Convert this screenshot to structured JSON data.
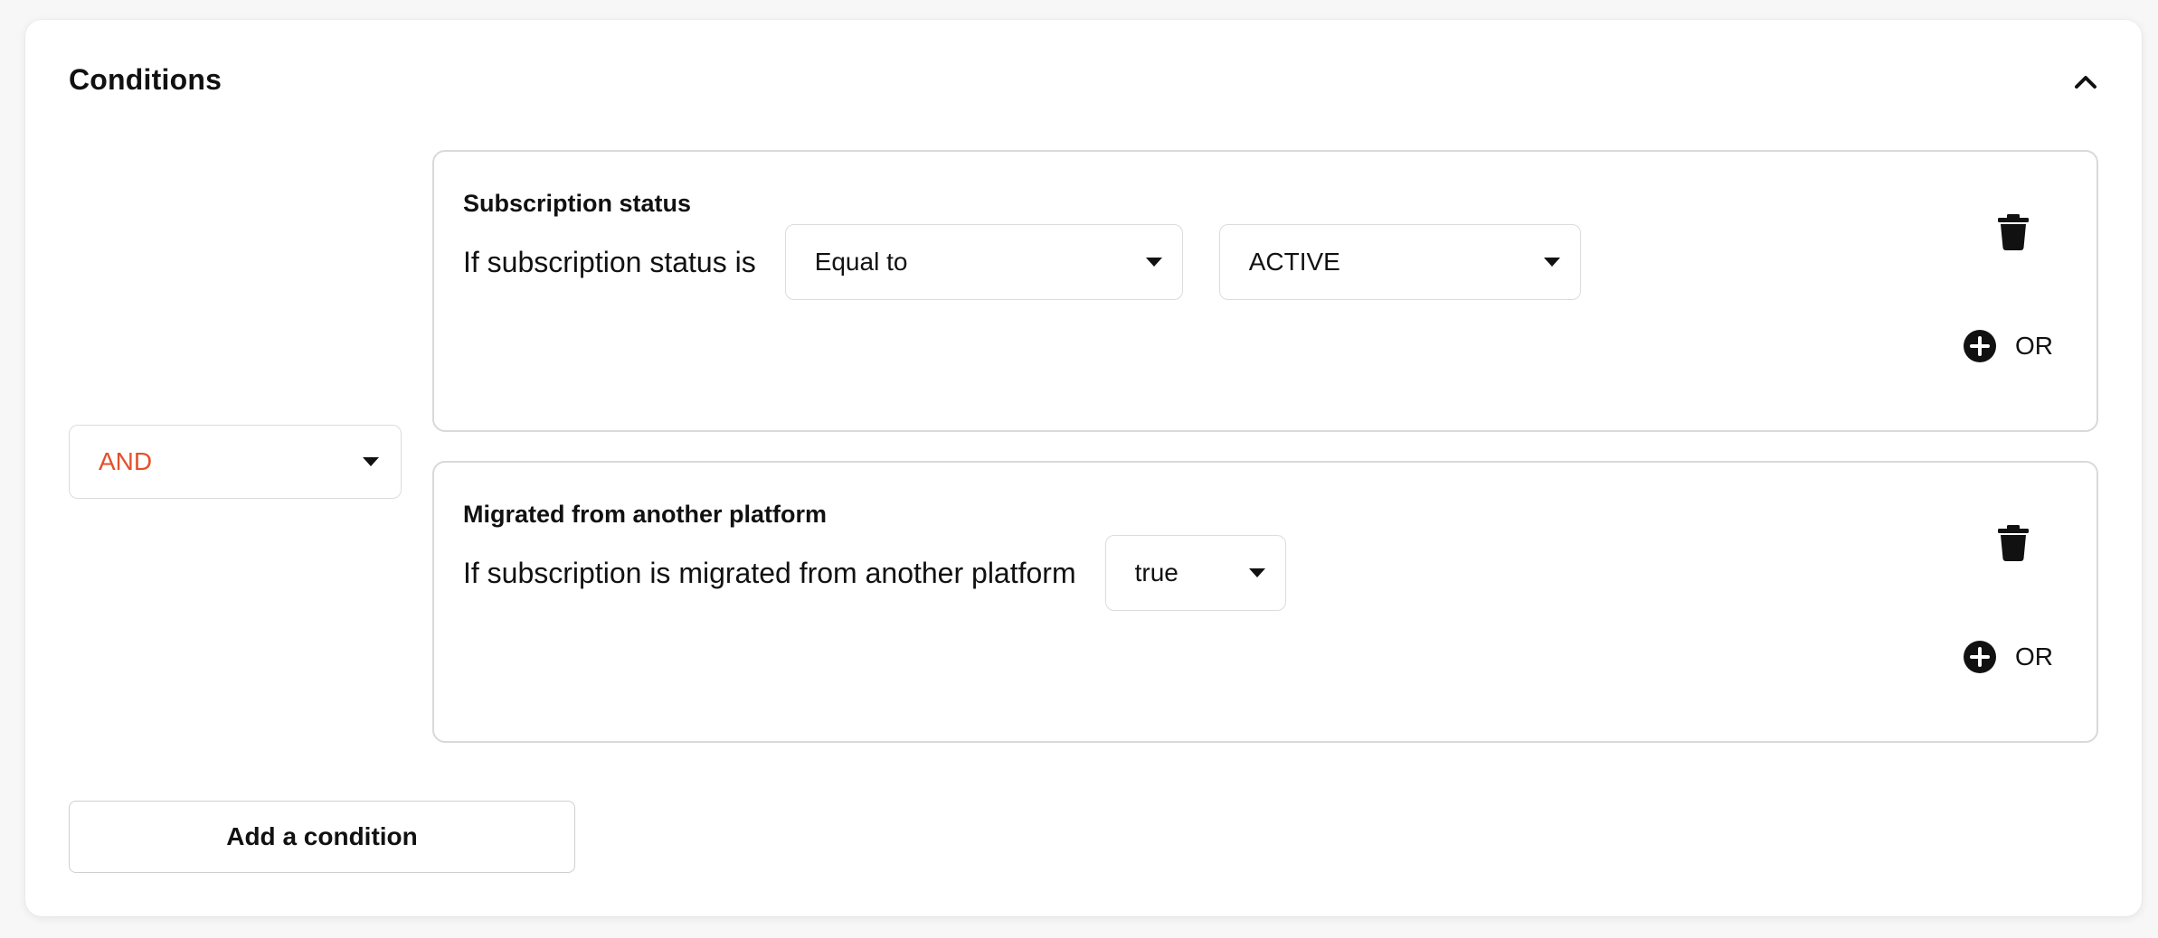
{
  "section": {
    "title": "Conditions",
    "collapse_icon": "chevron-up-icon"
  },
  "logic": {
    "selected": "AND",
    "color": "#e5502c"
  },
  "conditions": [
    {
      "title": "Subscription status",
      "text": "If subscription status is",
      "operator": "Equal to",
      "value": "ACTIVE",
      "or_label": "OR"
    },
    {
      "title": "Migrated from another platform",
      "text": "If subscription is migrated from another platform",
      "value": "true",
      "or_label": "OR"
    }
  ],
  "add_condition_label": "Add a condition"
}
